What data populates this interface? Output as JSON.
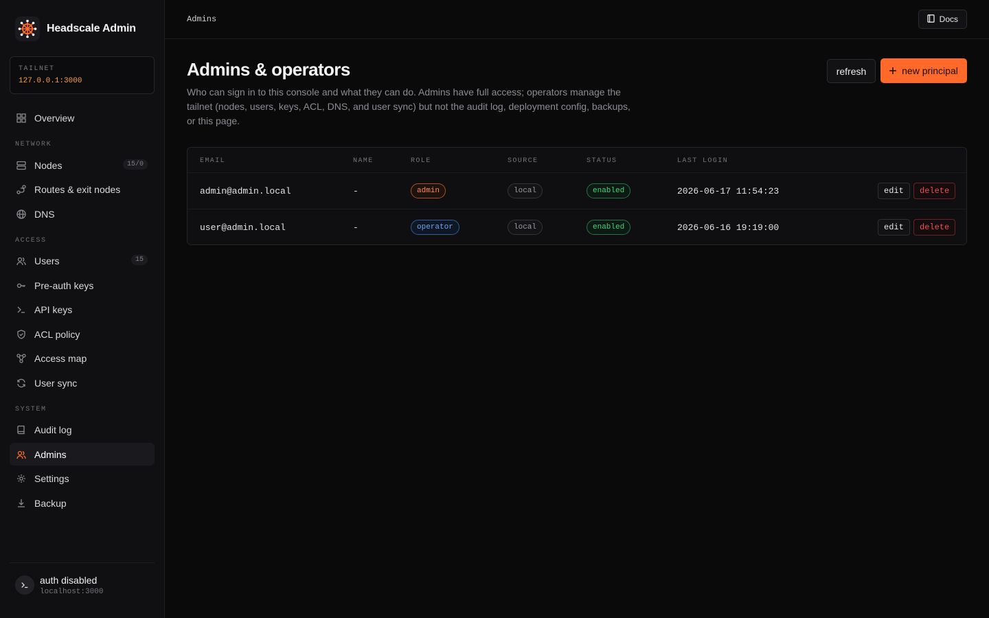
{
  "app": {
    "name": "Headscale Admin"
  },
  "tailnet": {
    "label": "TAILNET",
    "value": "127.0.0.1:3000"
  },
  "sidebar": {
    "overview": {
      "label": "Overview",
      "icon": "grid-icon"
    },
    "network_label": "NETWORK",
    "nodes": {
      "label": "Nodes",
      "badge": "15/0",
      "icon": "server-icon"
    },
    "routes": {
      "label": "Routes & exit nodes",
      "icon": "route-icon"
    },
    "dns": {
      "label": "DNS",
      "icon": "globe-icon"
    },
    "access_label": "ACCESS",
    "users": {
      "label": "Users",
      "badge": "15",
      "icon": "users-icon"
    },
    "preauth": {
      "label": "Pre-auth keys",
      "icon": "key-icon"
    },
    "apikeys": {
      "label": "API keys",
      "icon": "terminal-icon"
    },
    "acl": {
      "label": "ACL policy",
      "icon": "shield-icon"
    },
    "accessmap": {
      "label": "Access map",
      "icon": "network-icon"
    },
    "usersync": {
      "label": "User sync",
      "icon": "refresh-icon"
    },
    "system_label": "SYSTEM",
    "audit": {
      "label": "Audit log",
      "icon": "book-icon"
    },
    "admins": {
      "label": "Admins",
      "icon": "users-icon",
      "active": true
    },
    "settings": {
      "label": "Settings",
      "icon": "gear-icon"
    },
    "backup": {
      "label": "Backup",
      "icon": "download-icon"
    }
  },
  "auth": {
    "title": "auth disabled",
    "subtitle": "localhost:3000"
  },
  "topbar": {
    "breadcrumb": "Admins",
    "docs_label": "Docs"
  },
  "page": {
    "title": "Admins & operators",
    "description": "Who can sign in to this console and what they can do. Admins have full access; operators manage the tailnet (nodes, users, keys, ACL, DNS, and user sync) but not the audit log, deployment config, backups, or this page.",
    "refresh_label": "refresh",
    "new_label": "new principal"
  },
  "table": {
    "headers": {
      "email": "EMAIL",
      "name": "NAME",
      "role": "ROLE",
      "source": "SOURCE",
      "status": "STATUS",
      "last_login": "LAST LOGIN"
    },
    "rows": [
      {
        "email": "admin@admin.local",
        "name": "-",
        "role": "admin",
        "source": "local",
        "status": "enabled",
        "last_login": "2026-06-17 11:54:23",
        "edit": "edit",
        "delete": "delete"
      },
      {
        "email": "user@admin.local",
        "name": "-",
        "role": "operator",
        "source": "local",
        "status": "enabled",
        "last_login": "2026-06-16 19:19:00",
        "edit": "edit",
        "delete": "delete"
      }
    ]
  },
  "colors": {
    "accent": "#ff6a2b",
    "background": "#0a0a0b",
    "success": "#45d17f",
    "danger": "#ef4c57",
    "info": "#6fa6f0"
  }
}
